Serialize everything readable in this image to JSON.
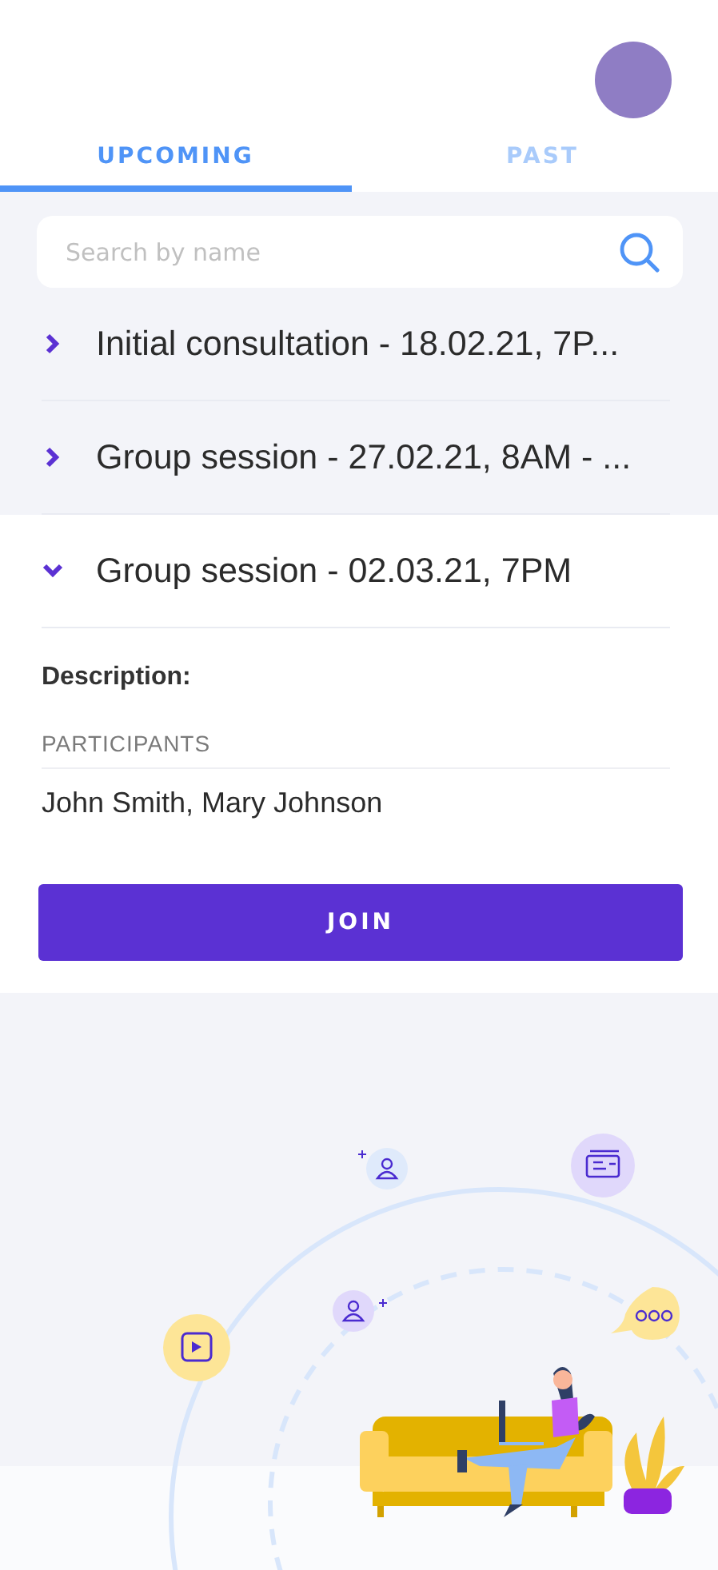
{
  "tabs": [
    {
      "label": "UPCOMING",
      "selected": true
    },
    {
      "label": "PAST",
      "selected": false
    }
  ],
  "search": {
    "placeholder": "Search by name"
  },
  "sessions": [
    {
      "title": "Initial consultation - 18.02.21, 7P...",
      "expanded": false
    },
    {
      "title": "Group session - 27.02.21, 8AM - ...",
      "expanded": false
    },
    {
      "title": "Group session - 02.03.21, 7PM",
      "expanded": true,
      "details": {
        "description_label": "Description:",
        "participants_label": "PARTICIPANTS",
        "participants": "John Smith, Mary Johnson",
        "button": "JOIN"
      }
    }
  ]
}
